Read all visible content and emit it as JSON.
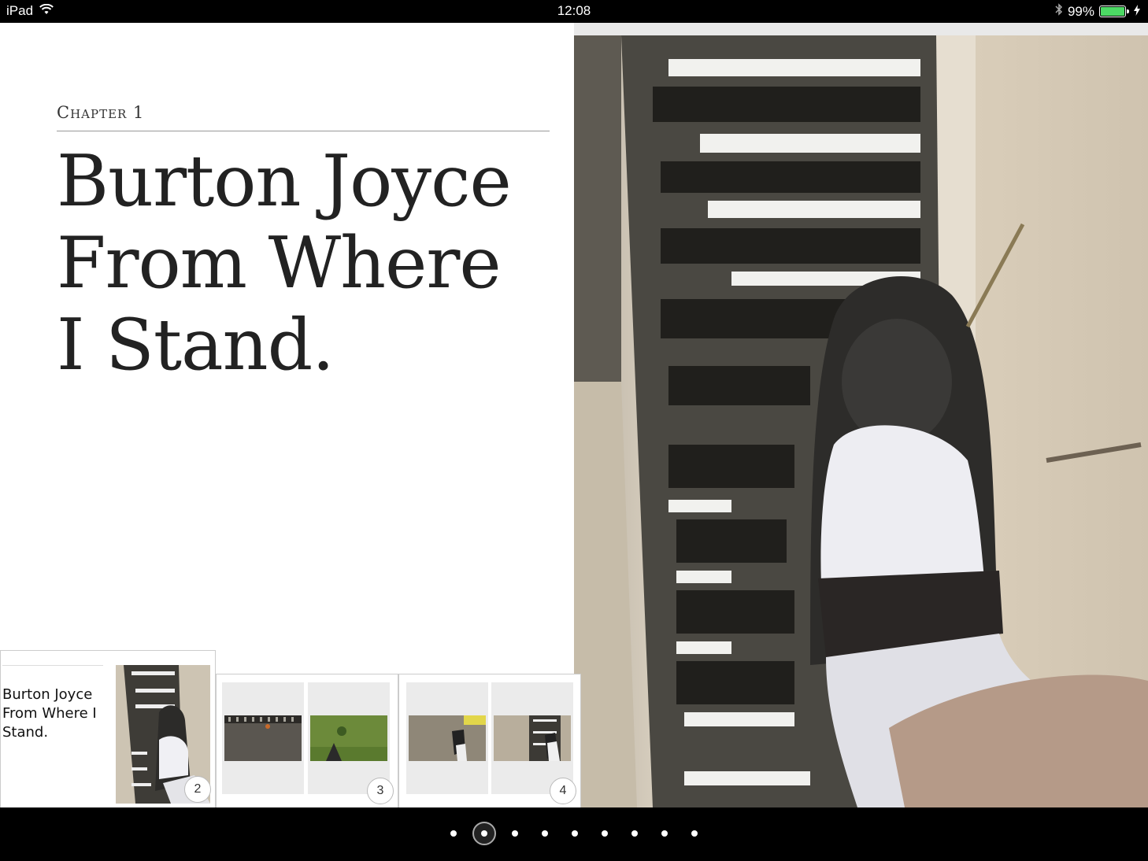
{
  "status": {
    "device": "iPad",
    "time": "12:08",
    "battery_percent": "99%",
    "battery_level": 0.99,
    "icons": [
      "wifi-icon",
      "bluetooth-icon",
      "charging-icon"
    ]
  },
  "chapter": {
    "label": "Chapter 1",
    "title_line1": "Burton Joyce",
    "title_line2": "From Where",
    "title_line3": "I Stand."
  },
  "navigator": {
    "cover_text": "Burton Joyce From Where I Stand.",
    "badges": [
      "2",
      "3",
      "4"
    ]
  },
  "page_dots": {
    "count": 9,
    "active_index": 1
  },
  "colors": {
    "battery": "#4cd964"
  }
}
